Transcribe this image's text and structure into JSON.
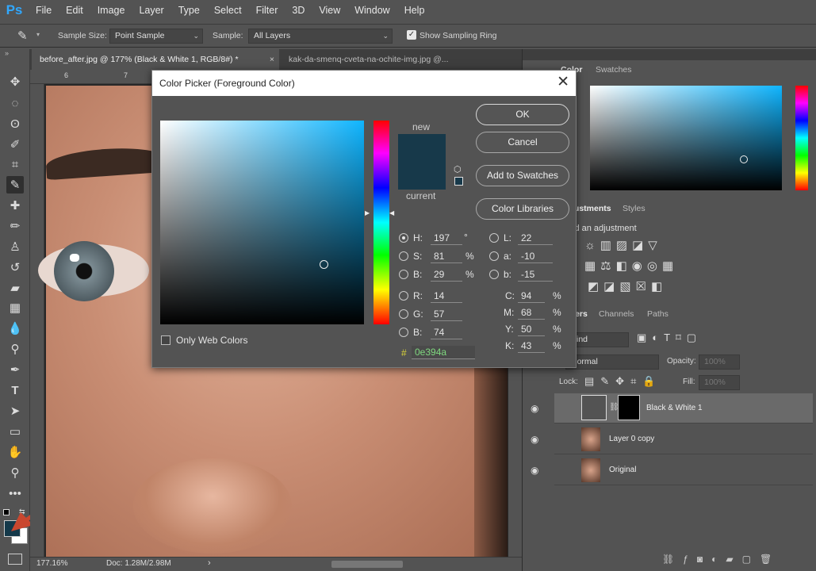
{
  "app": {
    "logo": "Ps",
    "menu": [
      "File",
      "Edit",
      "Image",
      "Layer",
      "Type",
      "Select",
      "Filter",
      "3D",
      "View",
      "Window",
      "Help"
    ]
  },
  "options": {
    "sample_size_label": "Sample Size:",
    "sample_size_value": "Point Sample",
    "sample_label": "Sample:",
    "sample_value": "All Layers",
    "show_ring_label": "Show Sampling Ring"
  },
  "docs": {
    "tab1": "before_after.jpg @ 177% (Black & White 1, RGB/8#) *",
    "tab2": "kak-da-smenq-cveta-na-ochite-img.jpg @...",
    "ruler_ticks": [
      "6",
      "7"
    ]
  },
  "status": {
    "zoom": "177.16%",
    "doc": "Doc: 1.28M/2.98M"
  },
  "panels": {
    "color_tabs": [
      "Color",
      "Swatches"
    ],
    "adj_tabs": [
      "Adjustments",
      "Styles"
    ],
    "adj_hint": "Add an adjustment",
    "layer_tabs": [
      "Layers",
      "Channels",
      "Paths"
    ],
    "kind": "Kind",
    "mode": "Normal",
    "opacity_label": "Opacity:",
    "opacity_value": "100%",
    "lock_label": "Lock:",
    "fill_label": "Fill:",
    "fill_value": "100%",
    "layers": [
      {
        "name": "Black & White 1"
      },
      {
        "name": "Layer 0 copy"
      },
      {
        "name": "Original"
      }
    ]
  },
  "dialog": {
    "title": "Color Picker (Foreground Color)",
    "new_label": "new",
    "current_label": "current",
    "buttons": {
      "ok": "OK",
      "cancel": "Cancel",
      "add": "Add to Swatches",
      "libraries": "Color Libraries"
    },
    "hsb": {
      "h": "197",
      "s": "81",
      "b": "29",
      "h_unit": "°",
      "pct": "%"
    },
    "rgb": {
      "r": "14",
      "g": "57",
      "b": "74"
    },
    "lab": {
      "l": "22",
      "a": "-10",
      "b": "-15"
    },
    "cmyk": {
      "c": "94",
      "m": "68",
      "y": "50",
      "k": "43"
    },
    "hex": "0e394a",
    "hash": "#",
    "only_web": "Only Web Colors",
    "labels": {
      "H": "H:",
      "S": "S:",
      "B": "B:",
      "R": "R:",
      "G": "G:",
      "Bb": "B:",
      "L": "L:",
      "a": "a:",
      "b": "b:",
      "C": "C:",
      "M": "M:",
      "Y": "Y:",
      "K": "K:"
    }
  },
  "colors": {
    "new": "#17394a",
    "current": "#17394a",
    "foreground": "#14394a",
    "accent": "#31a8ff"
  }
}
